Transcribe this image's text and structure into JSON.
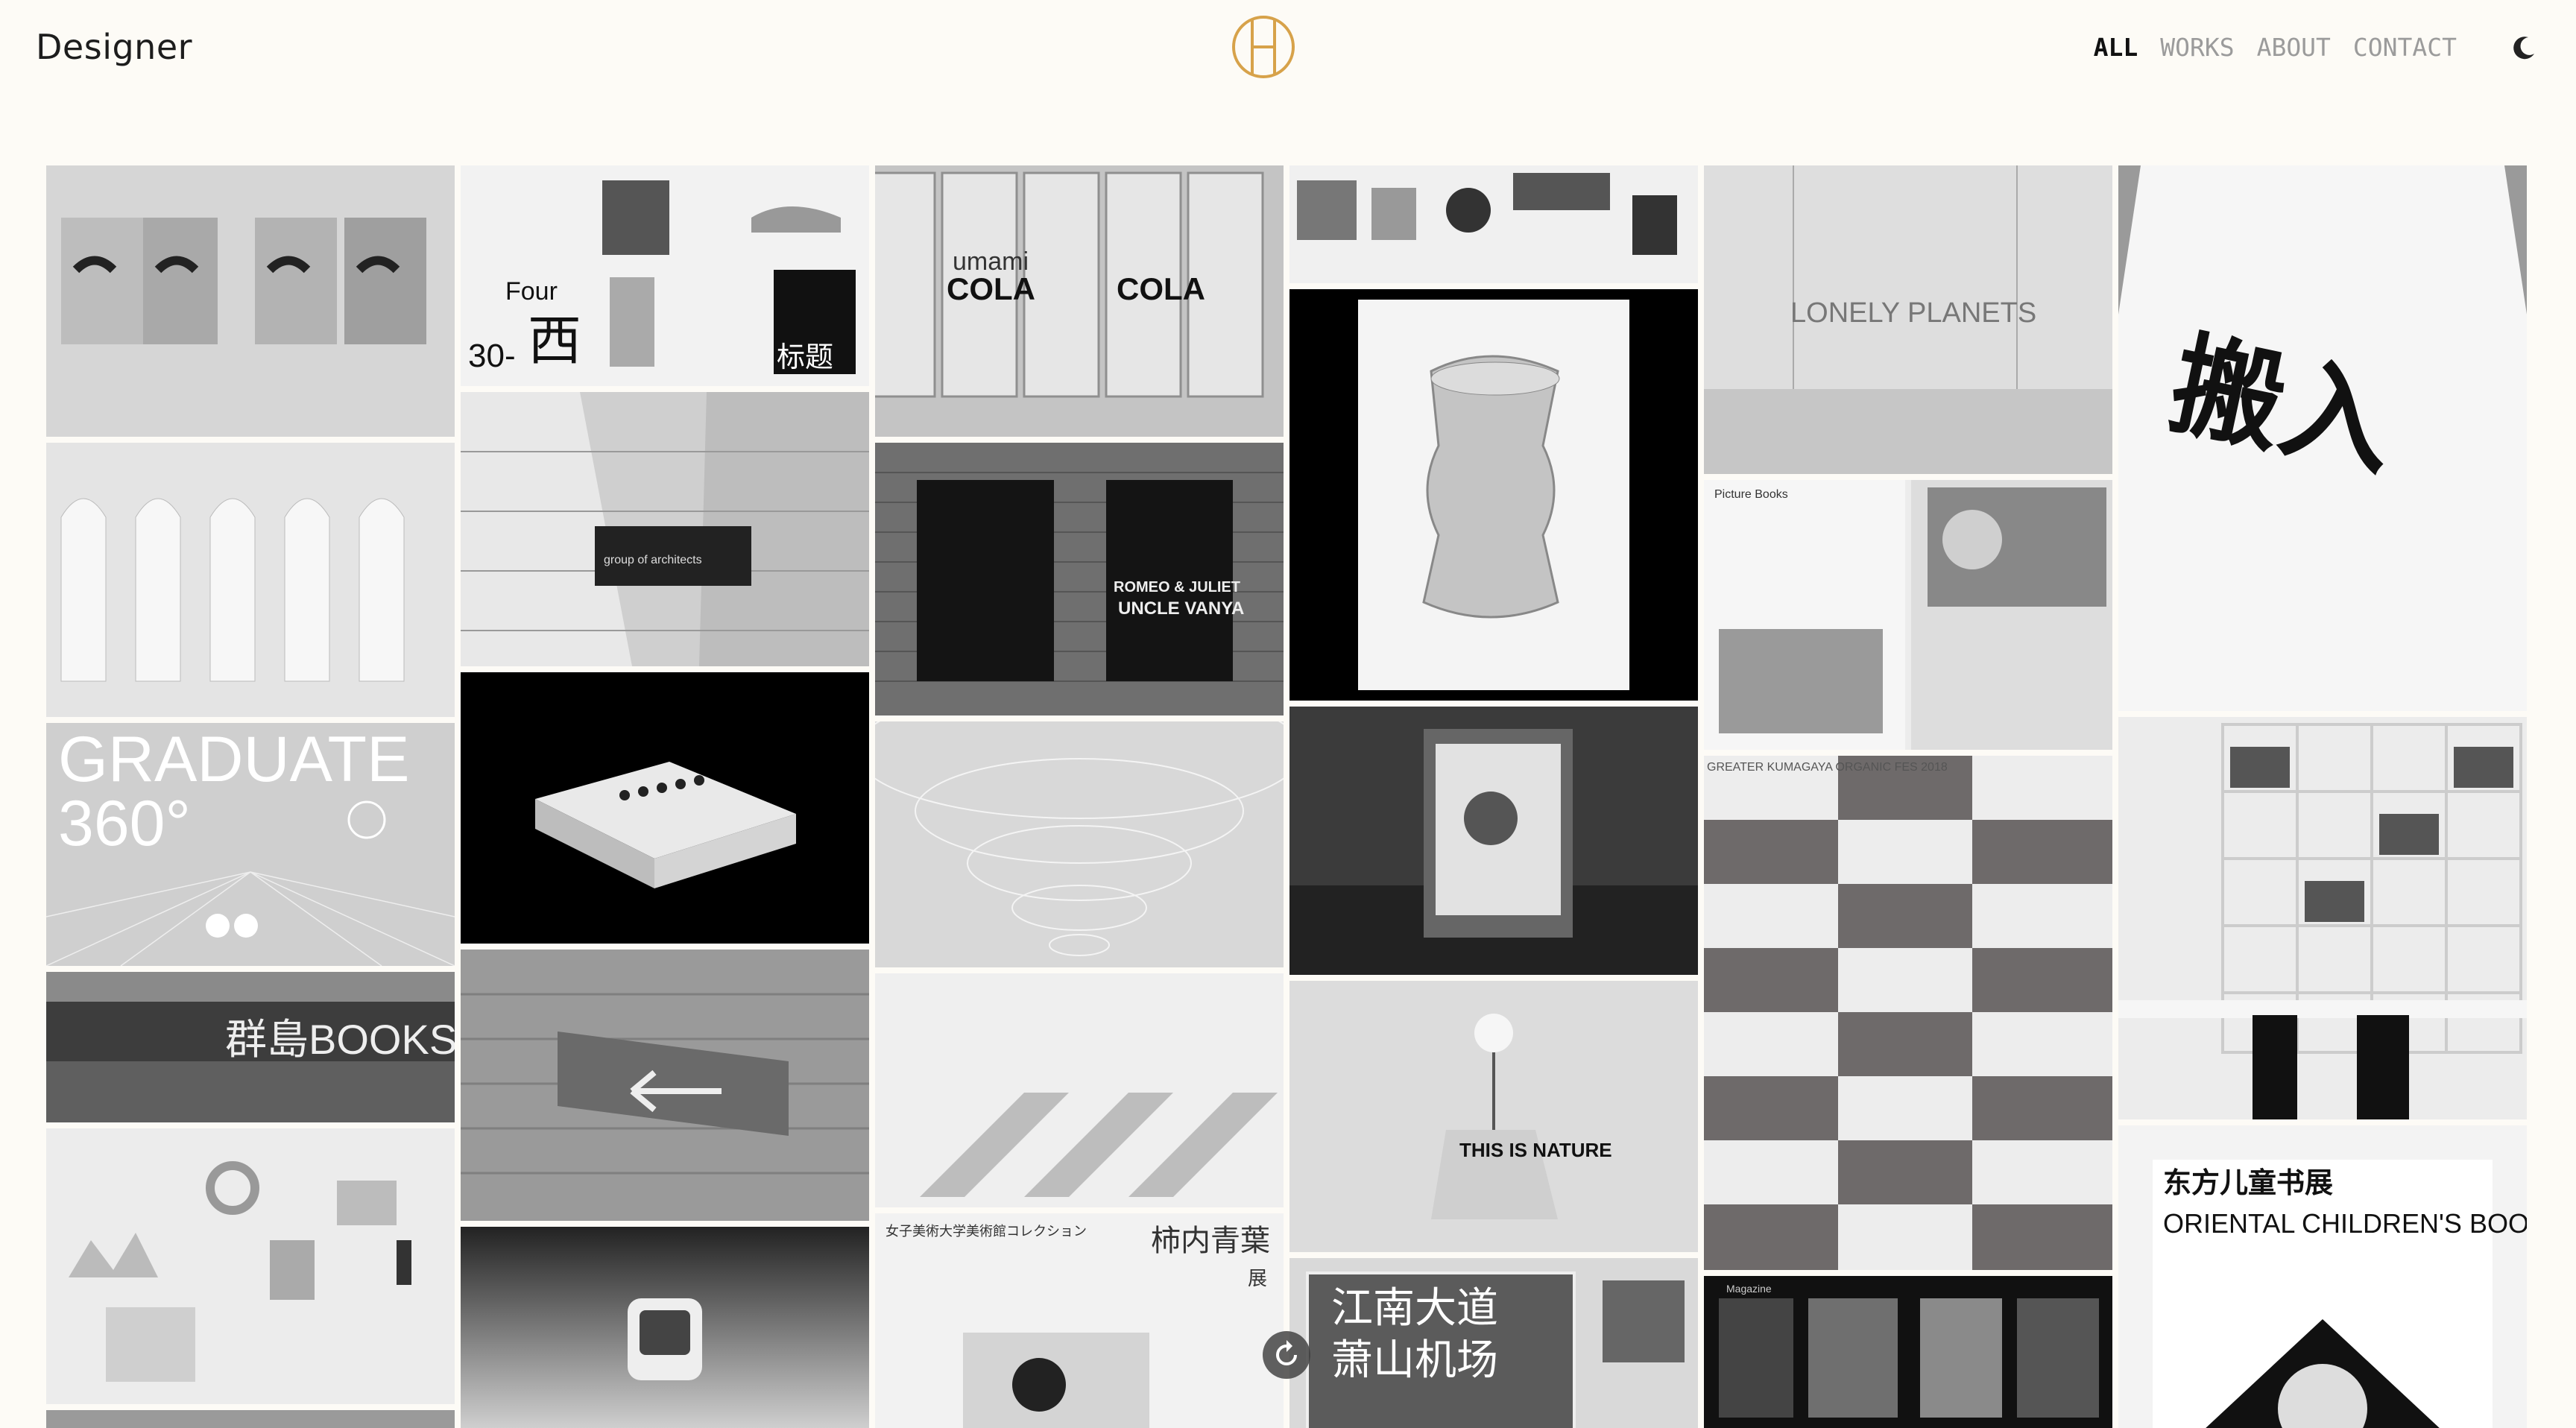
{
  "header": {
    "brand": "Designer",
    "nav": [
      {
        "label": "ALL",
        "active": true
      },
      {
        "label": "WORKS",
        "active": false
      },
      {
        "label": "ABOUT",
        "active": false
      },
      {
        "label": "CONTACT",
        "active": false
      }
    ],
    "theme_icon": "moon-icon",
    "logo_icon": "circle-h-monogram-icon",
    "accent": "#d7a24a"
  },
  "tiles": {
    "cola_brand": "umami",
    "cola_word": "COLA",
    "four": "Four",
    "nishi": "西",
    "thirty": "30-",
    "topic": "标题",
    "graduate": "GRADUATE",
    "degrees": "360°",
    "books": "群島BOOKS",
    "theatre_a": "ROMEO & JULIET",
    "theatre_b": "UNCLE VANYA",
    "lonely": "LONELY PLANETS",
    "tshirt": "搬入",
    "arch": "group of architects",
    "fes": "GREATER KUMAGAYA ORGANIC FES 2018",
    "nature": "THIS IS NATURE",
    "sign1": "江南大道",
    "sign2": "萧山机场",
    "japanese": "柿内青葉",
    "japanese_sub": "展",
    "museum": "女子美術大学美術館コレクション",
    "oriental_cn": "东方儿童书展",
    "oriental_en": "ORIENTAL CHILDREN'S BOOK FESTIVAL",
    "magazine": "Magazine",
    "picture_books": "Picture Books"
  },
  "controls": {
    "refresh_icon": "refresh-icon"
  }
}
